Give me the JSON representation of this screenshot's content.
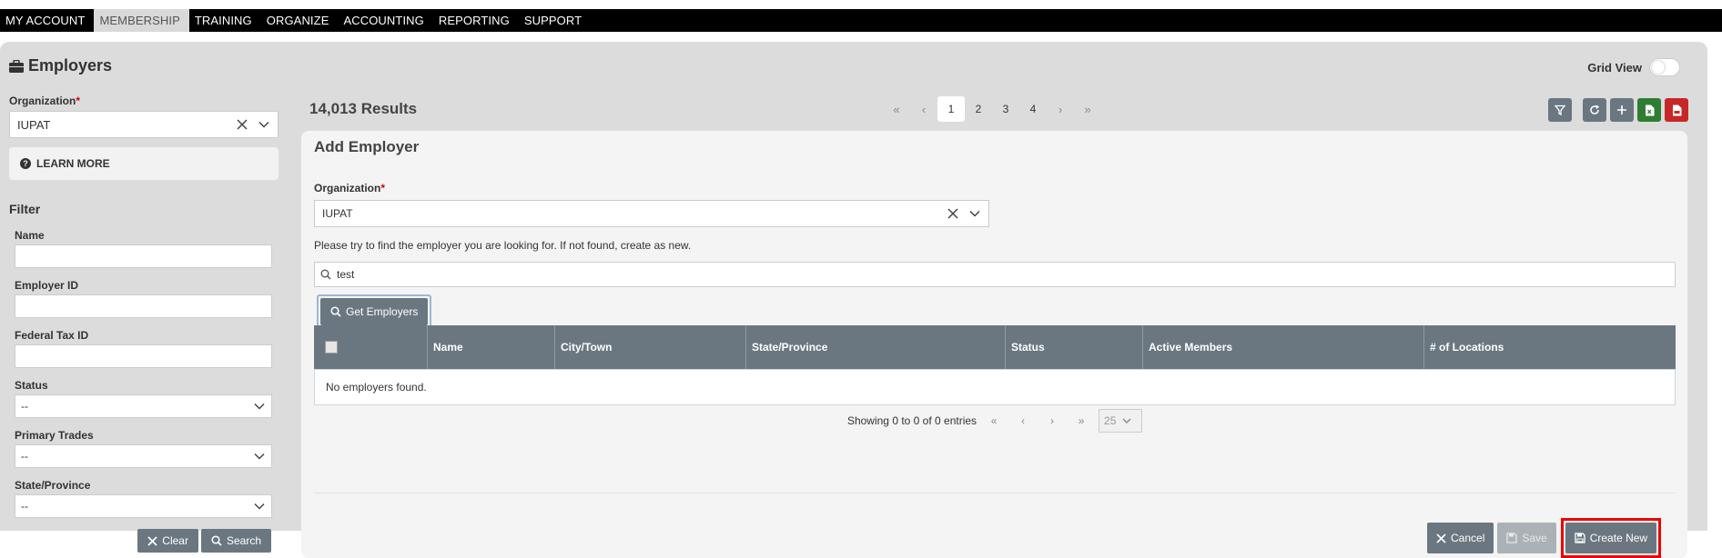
{
  "nav": {
    "items": [
      "MY ACCOUNT",
      "MEMBERSHIP",
      "TRAINING",
      "ORGANIZE",
      "ACCOUNTING",
      "REPORTING",
      "SUPPORT"
    ],
    "active": "MEMBERSHIP"
  },
  "page": {
    "title": "Employers",
    "title_icon": "briefcase-icon",
    "grid_view_label": "Grid View",
    "grid_view_on": false
  },
  "sidebar": {
    "org_label": "Organization",
    "org_value": "IUPAT",
    "learn_more": "LEARN MORE",
    "filter_title": "Filter",
    "fields": {
      "name": "Name",
      "employer_id": "Employer ID",
      "federal_tax_id": "Federal Tax ID",
      "status": "Status",
      "status_value": "--",
      "primary_trades": "Primary Trades",
      "primary_trades_value": "--",
      "state": "State/Province",
      "state_value": "--"
    },
    "clear_label": "Clear",
    "search_label": "Search"
  },
  "results": {
    "count_label": "14,013 Results",
    "pages": [
      "1",
      "2",
      "3",
      "4"
    ],
    "current_page": "1"
  },
  "toolbar": {
    "icons": [
      "filter-icon",
      "refresh-icon",
      "add-icon",
      "excel-export-icon",
      "pdf-export-icon"
    ]
  },
  "add_employer": {
    "title": "Add Employer",
    "org_label": "Organization",
    "org_value": "IUPAT",
    "hint": "Please try to find the employer you are looking for. If not found, create as new.",
    "search_value": "test",
    "get_button": "Get Employers",
    "columns": [
      "Name",
      "City/Town",
      "State/Province",
      "Status",
      "Active Members",
      "# of Locations"
    ],
    "empty_message": "No employers found.",
    "showing": "Showing 0 to 0 of 0 entries",
    "page_size": "25",
    "cancel_label": "Cancel",
    "save_label": "Save",
    "create_label": "Create New"
  },
  "colors": {
    "nav_bg": "#000000",
    "button_bg": "#6b7780",
    "highlight": "#e00000",
    "green": "#2e7d32",
    "red": "#c62828"
  }
}
